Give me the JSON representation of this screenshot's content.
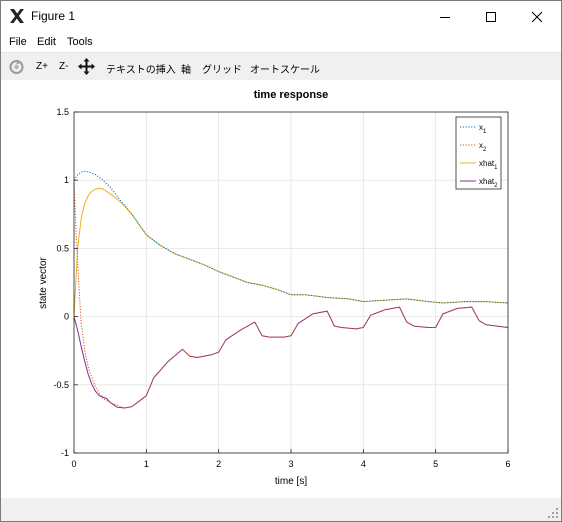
{
  "window": {
    "title": "Figure 1"
  },
  "menubar": {
    "items": [
      "File",
      "Edit",
      "Tools"
    ]
  },
  "toolbar": {
    "zoom_in": "Z+",
    "zoom_out": "Z-",
    "insert_text": "テキストの挿入",
    "axes": "軸",
    "grid": "グリッド",
    "autoscale": "オートスケール"
  },
  "colors": {
    "x1": "#0072bd",
    "x2": "#d95319",
    "xhat1": "#edb120",
    "xhat2": "#7e2f8e"
  },
  "chart_data": {
    "type": "line",
    "title": "time response",
    "xlabel": "time [s]",
    "ylabel": "state vector",
    "xlim": [
      0,
      6
    ],
    "ylim": [
      -1,
      1.5
    ],
    "xticks": [
      0,
      1,
      2,
      3,
      4,
      5,
      6
    ],
    "yticks": [
      -1,
      -0.5,
      0,
      0.5,
      1,
      1.5
    ],
    "ytick_labels": [
      "-1",
      "-0.5",
      "0",
      "0.5",
      "1",
      "1.5"
    ],
    "grid": true,
    "legend_position": "top-right",
    "series": [
      {
        "name": "x",
        "sub": "1",
        "style": "dotted",
        "color_key": "x1",
        "points": [
          [
            0,
            1
          ],
          [
            0.05,
            1.04
          ],
          [
            0.1,
            1.06
          ],
          [
            0.15,
            1.065
          ],
          [
            0.2,
            1.06
          ],
          [
            0.3,
            1.04
          ],
          [
            0.4,
            1.0
          ],
          [
            0.5,
            0.95
          ],
          [
            0.6,
            0.88
          ],
          [
            0.8,
            0.75
          ],
          [
            1.0,
            0.6
          ],
          [
            1.2,
            0.52
          ],
          [
            1.4,
            0.46
          ],
          [
            1.6,
            0.42
          ],
          [
            1.8,
            0.38
          ],
          [
            2.0,
            0.33
          ],
          [
            2.2,
            0.29
          ],
          [
            2.4,
            0.25
          ],
          [
            2.6,
            0.23
          ],
          [
            2.8,
            0.2
          ],
          [
            3.0,
            0.16
          ],
          [
            3.2,
            0.16
          ],
          [
            3.5,
            0.14
          ],
          [
            3.8,
            0.13
          ],
          [
            4.0,
            0.11
          ],
          [
            4.3,
            0.12
          ],
          [
            4.6,
            0.13
          ],
          [
            4.9,
            0.11
          ],
          [
            5.1,
            0.1
          ],
          [
            5.4,
            0.11
          ],
          [
            5.7,
            0.11
          ],
          [
            6.0,
            0.1
          ]
        ]
      },
      {
        "name": "x",
        "sub": "2",
        "style": "dotted",
        "color_key": "x2",
        "points": [
          [
            0,
            1
          ],
          [
            0.03,
            0.6
          ],
          [
            0.07,
            0.2
          ],
          [
            0.1,
            -0.05
          ],
          [
            0.15,
            -0.25
          ],
          [
            0.2,
            -0.38
          ],
          [
            0.3,
            -0.52
          ],
          [
            0.4,
            -0.6
          ],
          [
            0.5,
            -0.63
          ],
          [
            0.6,
            -0.65
          ],
          [
            0.7,
            -0.67
          ],
          [
            0.8,
            -0.66
          ],
          [
            0.9,
            -0.62
          ],
          [
            1.0,
            -0.58
          ],
          [
            1.1,
            -0.45
          ],
          [
            1.3,
            -0.33
          ],
          [
            1.5,
            -0.24
          ],
          [
            1.6,
            -0.29
          ],
          [
            1.7,
            -0.3
          ],
          [
            1.9,
            -0.28
          ],
          [
            2.0,
            -0.26
          ],
          [
            2.1,
            -0.17
          ],
          [
            2.3,
            -0.1
          ],
          [
            2.5,
            -0.04
          ],
          [
            2.6,
            -0.14
          ],
          [
            2.7,
            -0.15
          ],
          [
            2.9,
            -0.15
          ],
          [
            3.0,
            -0.14
          ],
          [
            3.1,
            -0.05
          ],
          [
            3.3,
            0.02
          ],
          [
            3.5,
            0.04
          ],
          [
            3.6,
            -0.07
          ],
          [
            3.7,
            -0.08
          ],
          [
            3.9,
            -0.09
          ],
          [
            4.0,
            -0.08
          ],
          [
            4.1,
            0.01
          ],
          [
            4.3,
            0.05
          ],
          [
            4.5,
            0.07
          ],
          [
            4.6,
            -0.04
          ],
          [
            4.7,
            -0.07
          ],
          [
            4.9,
            -0.08
          ],
          [
            5.0,
            -0.08
          ],
          [
            5.1,
            0.02
          ],
          [
            5.3,
            0.06
          ],
          [
            5.5,
            0.07
          ],
          [
            5.6,
            -0.03
          ],
          [
            5.7,
            -0.06
          ],
          [
            5.85,
            -0.07
          ],
          [
            6.0,
            -0.08
          ]
        ]
      },
      {
        "name": "xhat",
        "sub": "1",
        "style": "solid",
        "color_key": "xhat1",
        "points": [
          [
            0,
            0
          ],
          [
            0.05,
            0.5
          ],
          [
            0.1,
            0.72
          ],
          [
            0.15,
            0.83
          ],
          [
            0.2,
            0.89
          ],
          [
            0.25,
            0.92
          ],
          [
            0.3,
            0.935
          ],
          [
            0.35,
            0.94
          ],
          [
            0.4,
            0.935
          ],
          [
            0.5,
            0.9
          ],
          [
            0.6,
            0.86
          ],
          [
            0.7,
            0.81
          ],
          [
            0.8,
            0.75
          ],
          [
            1.0,
            0.6
          ],
          [
            1.2,
            0.52
          ],
          [
            1.4,
            0.46
          ],
          [
            1.6,
            0.42
          ],
          [
            1.8,
            0.38
          ],
          [
            2.0,
            0.33
          ],
          [
            2.2,
            0.29
          ],
          [
            2.4,
            0.25
          ],
          [
            2.6,
            0.23
          ],
          [
            2.8,
            0.2
          ],
          [
            3.0,
            0.16
          ],
          [
            3.2,
            0.16
          ],
          [
            3.5,
            0.14
          ],
          [
            3.8,
            0.13
          ],
          [
            4.0,
            0.11
          ],
          [
            4.3,
            0.12
          ],
          [
            4.6,
            0.13
          ],
          [
            4.9,
            0.11
          ],
          [
            5.1,
            0.1
          ],
          [
            5.4,
            0.11
          ],
          [
            5.7,
            0.11
          ],
          [
            6.0,
            0.1
          ]
        ]
      },
      {
        "name": "xhat",
        "sub": "2",
        "style": "solid",
        "color_key": "xhat2",
        "points": [
          [
            0,
            0
          ],
          [
            0.05,
            -0.1
          ],
          [
            0.1,
            -0.22
          ],
          [
            0.15,
            -0.33
          ],
          [
            0.2,
            -0.43
          ],
          [
            0.25,
            -0.5
          ],
          [
            0.3,
            -0.55
          ],
          [
            0.35,
            -0.58
          ],
          [
            0.4,
            -0.59
          ],
          [
            0.45,
            -0.6
          ],
          [
            0.5,
            -0.63
          ],
          [
            0.6,
            -0.665
          ],
          [
            0.7,
            -0.67
          ],
          [
            0.8,
            -0.66
          ],
          [
            0.9,
            -0.62
          ],
          [
            1.0,
            -0.58
          ],
          [
            1.1,
            -0.45
          ],
          [
            1.3,
            -0.33
          ],
          [
            1.5,
            -0.24
          ],
          [
            1.6,
            -0.29
          ],
          [
            1.7,
            -0.3
          ],
          [
            1.9,
            -0.28
          ],
          [
            2.0,
            -0.26
          ],
          [
            2.1,
            -0.17
          ],
          [
            2.3,
            -0.1
          ],
          [
            2.5,
            -0.04
          ],
          [
            2.6,
            -0.14
          ],
          [
            2.7,
            -0.15
          ],
          [
            2.9,
            -0.15
          ],
          [
            3.0,
            -0.14
          ],
          [
            3.1,
            -0.05
          ],
          [
            3.3,
            0.02
          ],
          [
            3.5,
            0.04
          ],
          [
            3.6,
            -0.07
          ],
          [
            3.7,
            -0.08
          ],
          [
            3.9,
            -0.09
          ],
          [
            4.0,
            -0.08
          ],
          [
            4.1,
            0.01
          ],
          [
            4.3,
            0.05
          ],
          [
            4.5,
            0.07
          ],
          [
            4.6,
            -0.04
          ],
          [
            4.7,
            -0.07
          ],
          [
            4.9,
            -0.08
          ],
          [
            5.0,
            -0.08
          ],
          [
            5.1,
            0.02
          ],
          [
            5.3,
            0.06
          ],
          [
            5.5,
            0.07
          ],
          [
            5.6,
            -0.03
          ],
          [
            5.7,
            -0.06
          ],
          [
            5.85,
            -0.07
          ],
          [
            6.0,
            -0.08
          ]
        ]
      }
    ]
  }
}
